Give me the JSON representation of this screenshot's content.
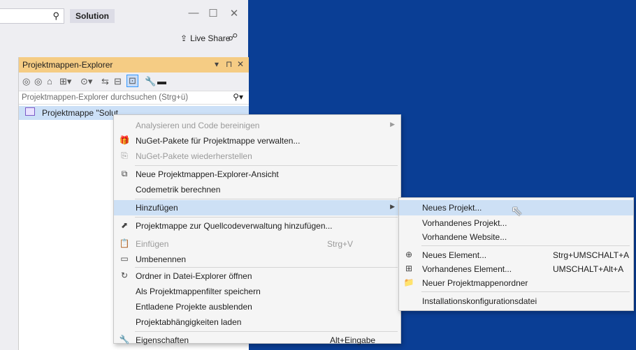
{
  "topbar": {
    "solution_badge": "Solution",
    "live_share": "Live Share",
    "minimize_glyph": "—",
    "maximize_glyph": "☐",
    "close_glyph": "✕"
  },
  "explorer": {
    "title": "Projektmappen-Explorer",
    "title_controls": "▾ ⊓ ✕",
    "search_placeholder": "Projektmappen-Explorer durchsuchen (Strg+ü)",
    "tree_item": "Projektmappe \"Solut"
  },
  "context_menu": {
    "items": [
      {
        "label": "Analysieren und Code bereinigen",
        "icon": "",
        "shortcut": "",
        "submenu": true,
        "disabled": true
      },
      {
        "label": "NuGet-Pakete für Projektmappe verwalten...",
        "icon": "gift-icon",
        "shortcut": "",
        "submenu": false,
        "disabled": false
      },
      {
        "label": "NuGet-Pakete wiederherstellen",
        "icon": "package-restore-icon",
        "shortcut": "",
        "submenu": false,
        "disabled": true
      },
      {
        "label": "Neue Projektmappen-Explorer-Ansicht",
        "icon": "new-view-icon",
        "shortcut": "",
        "submenu": false,
        "disabled": false
      },
      {
        "label": "Codemetrik berechnen",
        "icon": "",
        "shortcut": "",
        "submenu": false,
        "disabled": false
      },
      {
        "label": "Hinzufügen",
        "icon": "",
        "shortcut": "",
        "submenu": true,
        "disabled": false
      },
      {
        "label": "Projektmappe zur Quellcodeverwaltung hinzufügen...",
        "icon": "source-control-icon",
        "shortcut": "",
        "submenu": false,
        "disabled": false
      },
      {
        "label": "Einfügen",
        "icon": "paste-icon",
        "shortcut": "Strg+V",
        "submenu": false,
        "disabled": true
      },
      {
        "label": "Umbenennen",
        "icon": "rename-icon",
        "shortcut": "",
        "submenu": false,
        "disabled": false
      },
      {
        "label": "Ordner in Datei-Explorer öffnen",
        "icon": "open-folder-icon",
        "shortcut": "",
        "submenu": false,
        "disabled": false
      },
      {
        "label": "Als Projektmappenfilter speichern",
        "icon": "",
        "shortcut": "",
        "submenu": false,
        "disabled": false
      },
      {
        "label": "Entladene Projekte ausblenden",
        "icon": "",
        "shortcut": "",
        "submenu": false,
        "disabled": false
      },
      {
        "label": "Projektabhängigkeiten laden",
        "icon": "",
        "shortcut": "",
        "submenu": false,
        "disabled": false
      },
      {
        "label": "Eigenschaften",
        "icon": "wrench-icon",
        "shortcut": "Alt+Eingabe",
        "submenu": false,
        "disabled": false
      }
    ]
  },
  "submenu": {
    "items": [
      {
        "label": "Neues Projekt...",
        "icon": "",
        "shortcut": ""
      },
      {
        "label": "Vorhandenes Projekt...",
        "icon": "",
        "shortcut": ""
      },
      {
        "label": "Vorhandene Website...",
        "icon": "",
        "shortcut": ""
      },
      {
        "label": "Neues Element...",
        "icon": "new-item-icon",
        "shortcut": "Strg+UMSCHALT+A"
      },
      {
        "label": "Vorhandenes Element...",
        "icon": "existing-item-icon",
        "shortcut": "UMSCHALT+Alt+A"
      },
      {
        "label": "Neuer Projektmappenordner",
        "icon": "solution-folder-icon",
        "shortcut": ""
      },
      {
        "label": "Installationskonfigurationsdatei",
        "icon": "",
        "shortcut": ""
      }
    ]
  },
  "colors": {
    "desktop": "#0a3e95",
    "panel_title": "#f5cc84",
    "highlight": "#cde0f5"
  }
}
